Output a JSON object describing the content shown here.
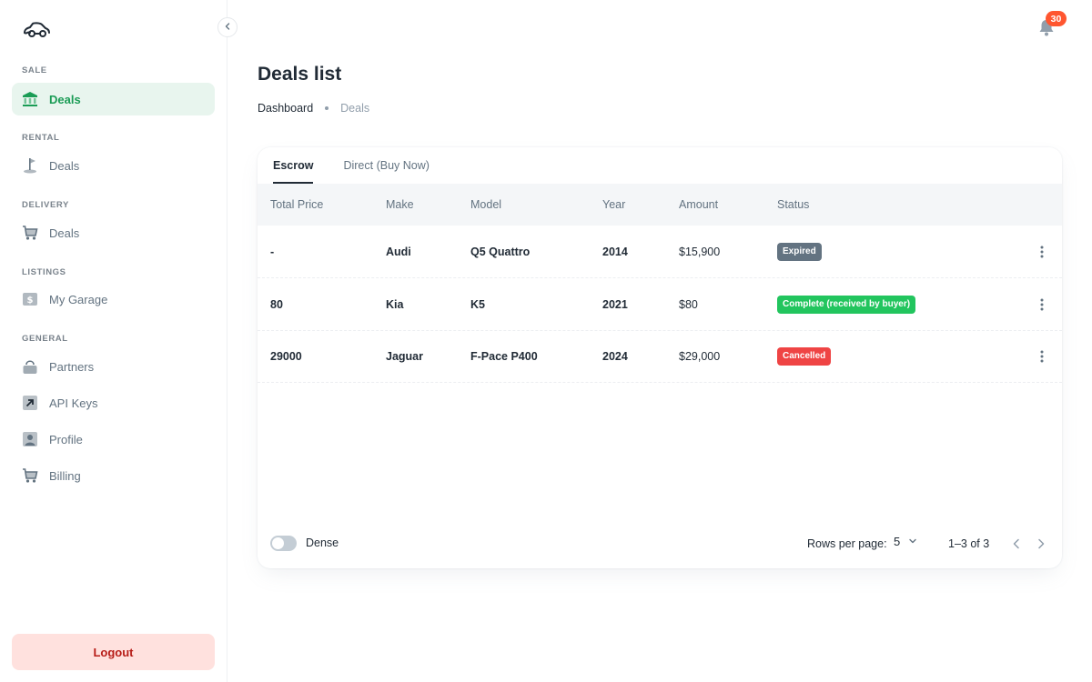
{
  "sidebar": {
    "sections": [
      {
        "label": "SALE"
      },
      {
        "label": "RENTAL"
      },
      {
        "label": "DELIVERY"
      },
      {
        "label": "LISTINGS"
      },
      {
        "label": "GENERAL"
      }
    ],
    "items": [
      {
        "label": "Deals",
        "icon": "bank-icon",
        "active": true
      },
      {
        "label": "Deals",
        "icon": "golf-flag-icon"
      },
      {
        "label": "Deals",
        "icon": "cart-icon"
      },
      {
        "label": "My Garage",
        "icon": "dollar-tag-icon"
      },
      {
        "label": "Partners",
        "icon": "bag-icon"
      },
      {
        "label": "API Keys",
        "icon": "arrow-up-right-icon"
      },
      {
        "label": "Profile",
        "icon": "user-icon"
      },
      {
        "label": "Billing",
        "icon": "cart-icon"
      }
    ],
    "logout_label": "Logout"
  },
  "topbar": {
    "notification_count": "30"
  },
  "header": {
    "title": "Deals list",
    "breadcrumb": [
      "Dashboard",
      "Deals"
    ]
  },
  "tabs": [
    {
      "label": "Escrow",
      "active": true
    },
    {
      "label": "Direct (Buy Now)"
    }
  ],
  "table": {
    "columns": [
      "Total Price",
      "Make",
      "Model",
      "Year",
      "Amount",
      "Status"
    ],
    "rows": [
      {
        "total_price": "-",
        "make": "Audi",
        "model": "Q5 Quattro",
        "year": "2014",
        "amount": "$15,900",
        "status": "Expired",
        "status_color": "#637381"
      },
      {
        "total_price": "80",
        "make": "Kia",
        "model": "K5",
        "year": "2021",
        "amount": "$80",
        "status": "Complete (received by buyer)",
        "status_color": "#22c55e"
      },
      {
        "total_price": "29000",
        "make": "Jaguar",
        "model": "F-Pace P400",
        "year": "2024",
        "amount": "$29,000",
        "status": "Cancelled",
        "status_color": "#ef4444"
      }
    ]
  },
  "footer": {
    "dense_label": "Dense",
    "dense_on": false,
    "rows_per_page_label": "Rows per page:",
    "rows_per_page_value": "5",
    "range_text": "1–3 of 3"
  },
  "colors": {
    "accent": "#1a9c55",
    "accent_bg": "#e8f5ee",
    "logout_bg": "#ffe1de",
    "logout_text": "#b71d18",
    "badge": "#ff5630"
  }
}
